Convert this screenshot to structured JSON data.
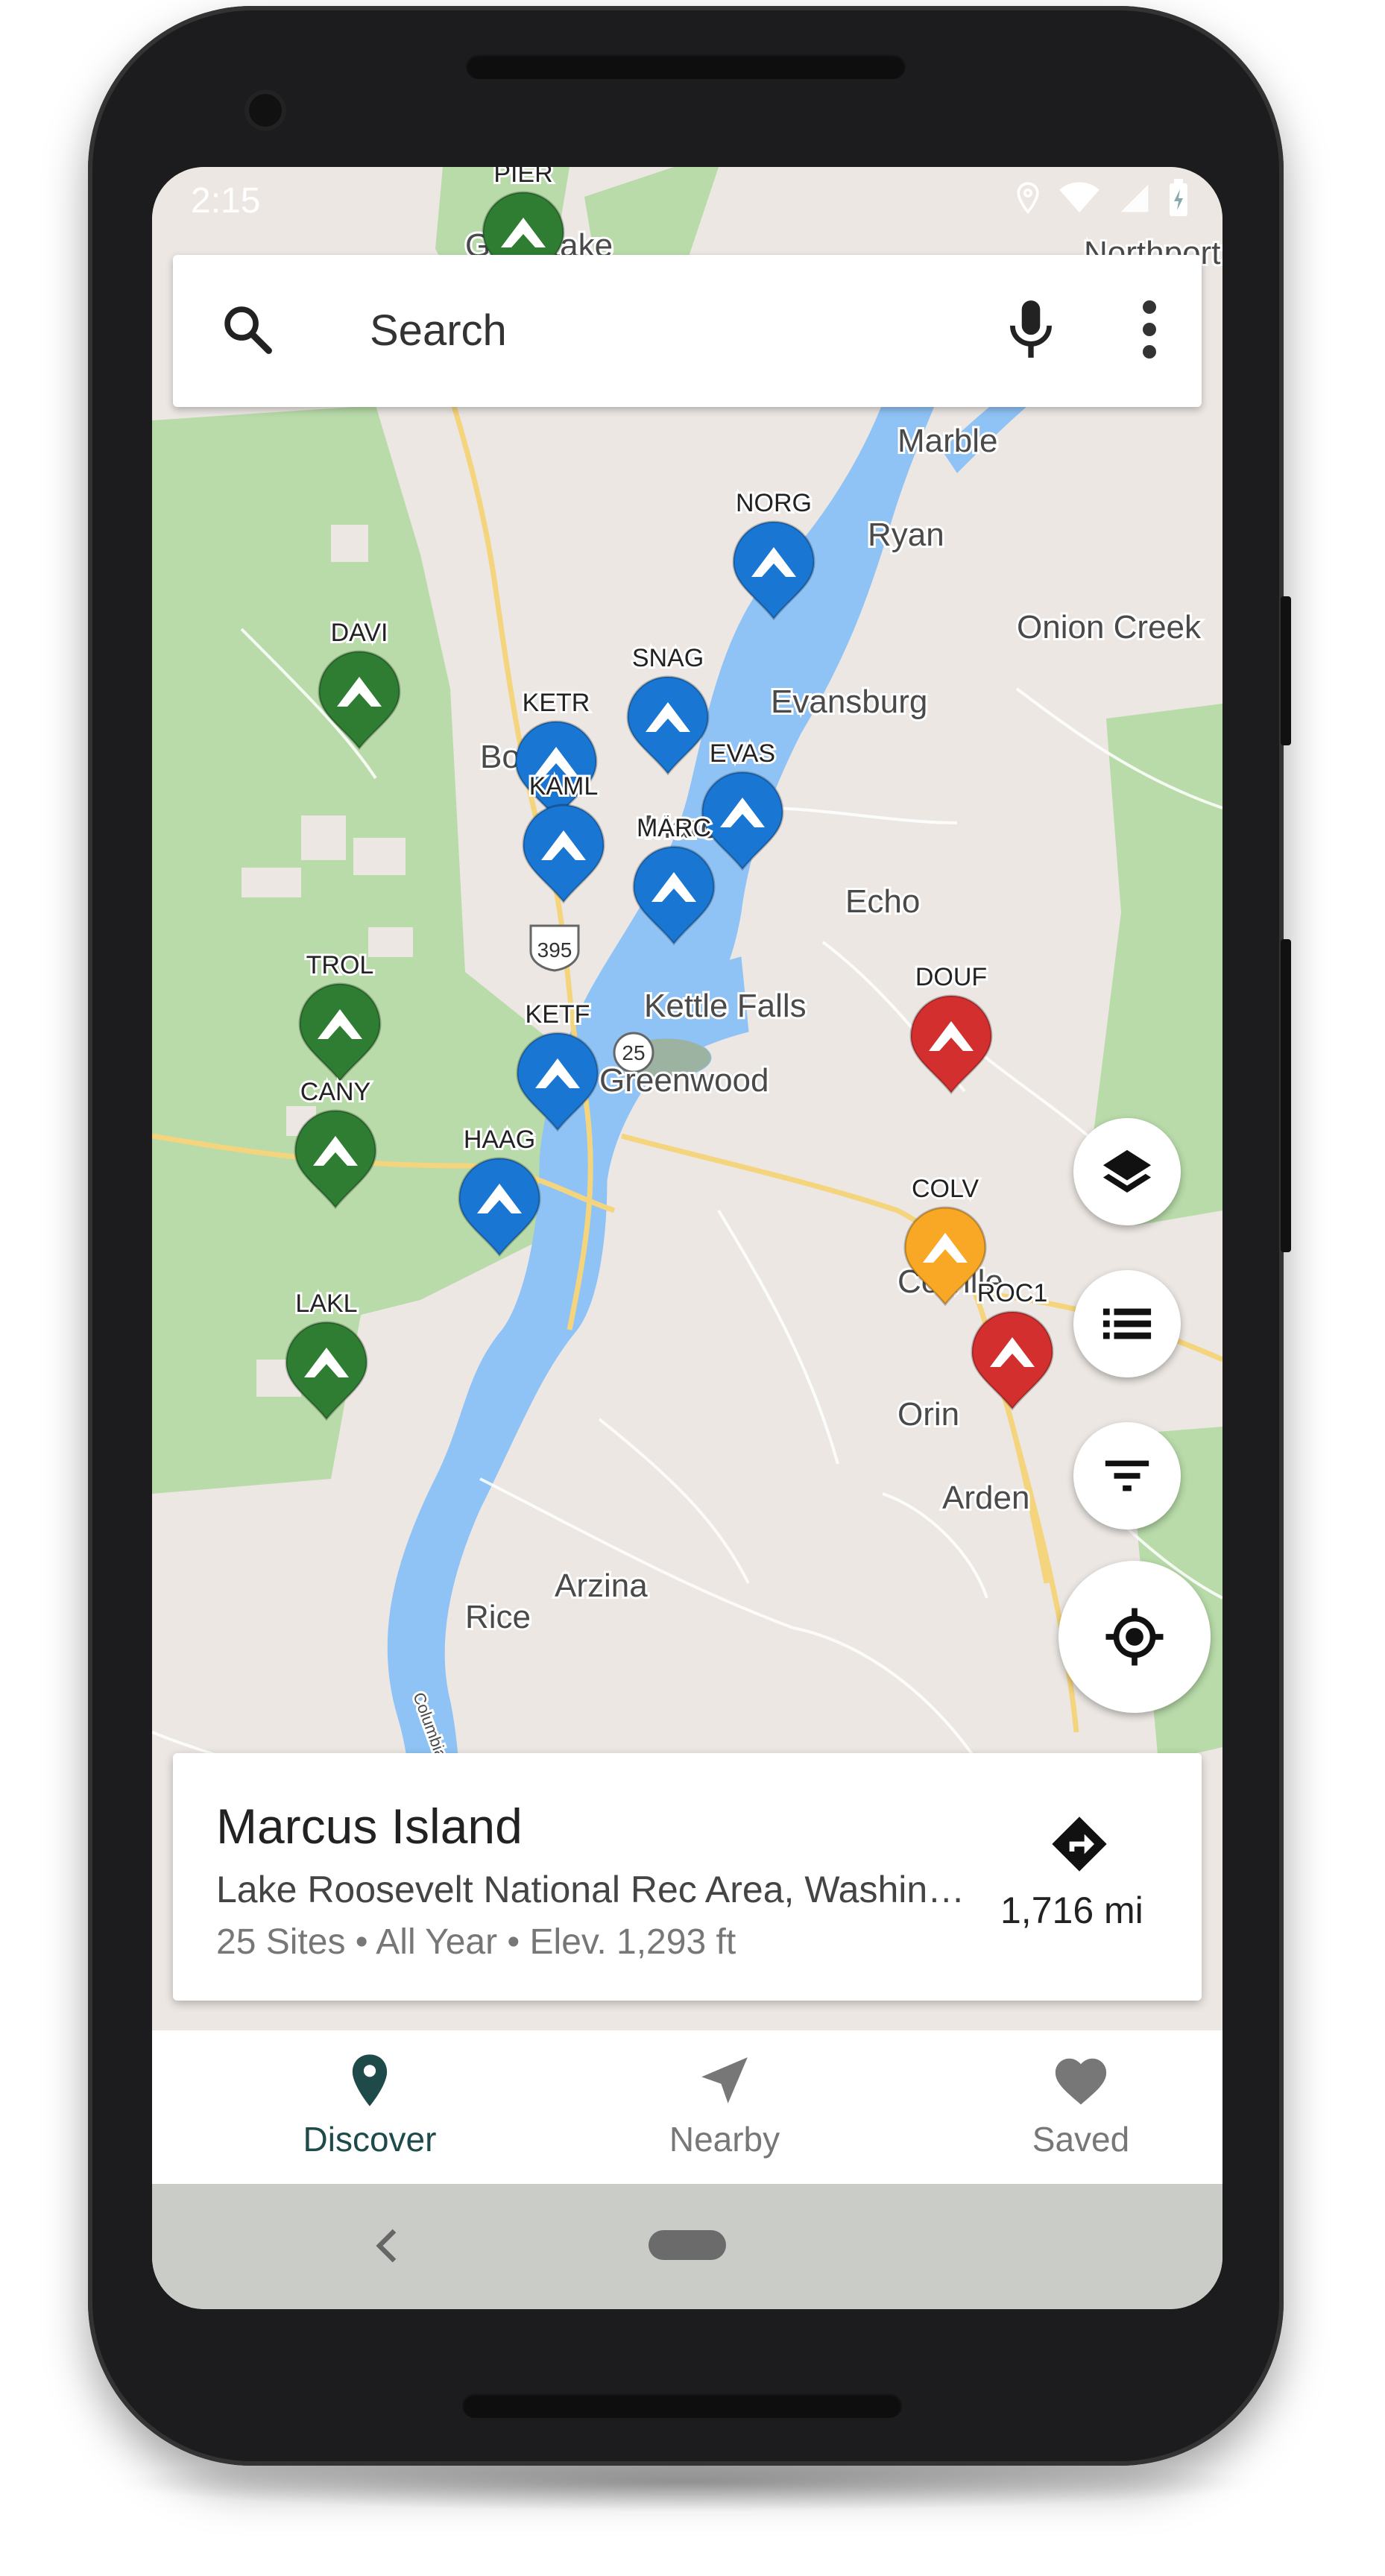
{
  "status_bar": {
    "time": "2:15"
  },
  "search": {
    "placeholder": "Search"
  },
  "map": {
    "places": [
      {
        "name": "Goldstake",
        "size": "md"
      },
      {
        "name": "Northport",
        "size": "md"
      },
      {
        "name": "Marble",
        "size": "md"
      },
      {
        "name": "Ryan",
        "size": "md"
      },
      {
        "name": "Onion Creek",
        "size": "md"
      },
      {
        "name": "Evansburg",
        "size": "md"
      },
      {
        "name": "Boyds",
        "size": "md"
      },
      {
        "name": "Marcus",
        "size": "md"
      },
      {
        "name": "Echo",
        "size": "md"
      },
      {
        "name": "Kettle Falls",
        "size": "md"
      },
      {
        "name": "Greenwood",
        "size": "md"
      },
      {
        "name": "Colville",
        "size": "md"
      },
      {
        "name": "Orin",
        "size": "md"
      },
      {
        "name": "Arden",
        "size": "md"
      },
      {
        "name": "Arzina",
        "size": "md"
      },
      {
        "name": "Rice",
        "size": "md"
      },
      {
        "name": "Columbia River",
        "size": "sm"
      }
    ],
    "highways": [
      "395",
      "25"
    ],
    "campgrounds": [
      {
        "code": "PIER",
        "color": "#2e7d32"
      },
      {
        "code": "NORG",
        "color": "#1976d2"
      },
      {
        "code": "DAVI",
        "color": "#2e7d32"
      },
      {
        "code": "SNAG",
        "color": "#1976d2"
      },
      {
        "code": "KETR",
        "color": "#1976d2"
      },
      {
        "code": "EVAS",
        "color": "#1976d2"
      },
      {
        "code": "KAML",
        "color": "#1976d2"
      },
      {
        "code": "MARC",
        "color": "#1976d2"
      },
      {
        "code": "TROL",
        "color": "#2e7d32"
      },
      {
        "code": "DOUF",
        "color": "#d32f2f"
      },
      {
        "code": "KETF",
        "color": "#1976d2"
      },
      {
        "code": "CANY",
        "color": "#2e7d32"
      },
      {
        "code": "HAAG",
        "color": "#1976d2"
      },
      {
        "code": "COLV",
        "color": "#f9a825"
      },
      {
        "code": "ROC1",
        "color": "#d32f2f"
      },
      {
        "code": "LAKL",
        "color": "#2e7d32"
      }
    ]
  },
  "fabs": [
    "layers-icon",
    "list-icon",
    "filter-icon",
    "my-location-icon"
  ],
  "selected": {
    "title": "Marcus Island",
    "subtitle": "Lake Roosevelt National Rec Area, Washin…",
    "meta": "25 Sites • All Year • Elev. 1,293 ft",
    "distance": "1,716 mi"
  },
  "nav": [
    {
      "label": "Discover",
      "icon": "location-pin-icon",
      "active": true
    },
    {
      "label": "Nearby",
      "icon": "navigation-arrow-icon",
      "active": false
    },
    {
      "label": "Saved",
      "icon": "heart-icon",
      "active": false
    }
  ],
  "colors": {
    "accent": "#1e4a4a",
    "inactive": "#777777",
    "park": "#b5d9a8",
    "water": "#8fc3f5",
    "road": "#f4d47c"
  }
}
